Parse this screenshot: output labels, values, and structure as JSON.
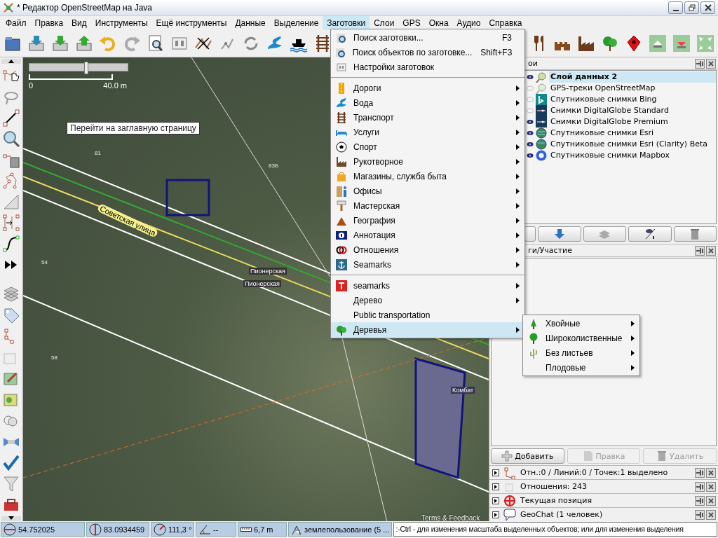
{
  "window": {
    "title": "* Редактор OpenStreetMap на Java"
  },
  "menu_bar": [
    {
      "label": "Файл",
      "selected": false
    },
    {
      "label": "Правка",
      "selected": false
    },
    {
      "label": "Вид",
      "selected": false
    },
    {
      "label": "Инструменты",
      "selected": false
    },
    {
      "label": "Ещё инструменты",
      "selected": false
    },
    {
      "label": "Данные",
      "selected": false
    },
    {
      "label": "Выделение",
      "selected": false
    },
    {
      "label": "Заготовки",
      "selected": true
    },
    {
      "label": "Слои",
      "selected": false
    },
    {
      "label": "GPS",
      "selected": false
    },
    {
      "label": "Окна",
      "selected": false
    },
    {
      "label": "Аудио",
      "selected": false
    },
    {
      "label": "Справка",
      "selected": false
    }
  ],
  "presets_menu": {
    "sections": [
      [
        {
          "label": "Поиск заготовки...",
          "shortcut": "F3",
          "submenu": false,
          "selected": false
        },
        {
          "label": "Поиск объектов по заготовке...",
          "shortcut": "Shift+F3",
          "submenu": false,
          "selected": false
        },
        {
          "label": "Настройки заготовок",
          "submenu": false,
          "selected": false
        }
      ],
      [
        {
          "label": "Дороги",
          "submenu": true,
          "selected": false
        },
        {
          "label": "Вода",
          "submenu": true,
          "selected": false
        },
        {
          "label": "Транспорт",
          "submenu": true,
          "selected": false
        },
        {
          "label": "Услуги",
          "submenu": true,
          "selected": false
        },
        {
          "label": "Спорт",
          "submenu": true,
          "selected": false
        },
        {
          "label": "Рукотворное",
          "submenu": true,
          "selected": false
        },
        {
          "label": "Магазины, служба быта",
          "submenu": true,
          "selected": false
        },
        {
          "label": "Офисы",
          "submenu": true,
          "selected": false
        },
        {
          "label": "Мастерская",
          "submenu": true,
          "selected": false
        },
        {
          "label": "География",
          "submenu": true,
          "selected": false
        },
        {
          "label": "Аннотация",
          "submenu": true,
          "selected": false
        },
        {
          "label": "Отношения",
          "submenu": true,
          "selected": false
        },
        {
          "label": "Seamarks",
          "submenu": true,
          "selected": false
        }
      ],
      [
        {
          "label": "seamarks",
          "submenu": true,
          "selected": false
        },
        {
          "label": "Дерево",
          "submenu": true,
          "selected": false
        },
        {
          "label": "Public transportation",
          "submenu": false,
          "selected": false
        },
        {
          "label": "Деревья",
          "submenu": true,
          "selected": true
        }
      ]
    ]
  },
  "trees_submenu": [
    {
      "label": "Хвойные",
      "submenu": true
    },
    {
      "label": "Широколиственные",
      "submenu": true
    },
    {
      "label": "Без листьев",
      "submenu": true
    },
    {
      "label": "Плодовые",
      "submenu": true
    }
  ],
  "map": {
    "zoom_slider": {
      "level": 0.58
    },
    "scale": {
      "start": "0",
      "end": "40.0 m"
    },
    "labels": [
      {
        "kind": "tooltip",
        "text": "Перейти на заглавную страницу"
      },
      {
        "kind": "house",
        "text": "81"
      },
      {
        "kind": "house",
        "text": "83Б"
      },
      {
        "kind": "street",
        "text": "Советская улица"
      },
      {
        "kind": "house",
        "text": "54"
      },
      {
        "kind": "stop",
        "text": "Пионерская"
      },
      {
        "kind": "stop",
        "text": "Пионерская"
      },
      {
        "kind": "house",
        "text": "58"
      },
      {
        "kind": "poi",
        "text": "Комбат"
      },
      {
        "kind": "attribution",
        "text": "Terms & Feedback"
      }
    ]
  },
  "layers_panel": {
    "title": "ои",
    "layers": [
      {
        "name": "Слой данных 2",
        "visible": true,
        "selected": true
      },
      {
        "name": "GPS-треки OpenStreetMap",
        "visible": false,
        "selected": false
      },
      {
        "name": "Спутниковые снимки Bing",
        "visible": false,
        "selected": false
      },
      {
        "name": "Снимки DigitalGlobe Standard",
        "visible": false,
        "selected": false
      },
      {
        "name": "Снимки DigitalGlobe Premium",
        "visible": true,
        "selected": false
      },
      {
        "name": "Спутниковые снимки Esri",
        "visible": true,
        "selected": false
      },
      {
        "name": "Спутниковые снимки Esri (Clarity) Beta",
        "visible": true,
        "selected": false
      },
      {
        "name": "Спутниковые снимки Mapbox",
        "visible": true,
        "selected": false
      }
    ]
  },
  "tags_panel": {
    "title": "ги/Участие",
    "buttons": [
      {
        "label": "Добавить",
        "disabled": false
      },
      {
        "label": "Правка",
        "disabled": true
      },
      {
        "label": "Удалить",
        "disabled": true
      }
    ]
  },
  "collapsed_panels": [
    {
      "title": "Отн.:0 / Линий:0 / Точек:1 выделено"
    },
    {
      "title": "Отношения: 243"
    },
    {
      "title": "Текущая позиция"
    },
    {
      "title": "GeoChat (1 человек)"
    }
  ],
  "status_bar": {
    "latitude": "54.752025",
    "longitude": "83.0934459",
    "heading": "111,3 °",
    "angle": "--",
    "distance": "6,7 m",
    "tags": "землепользование (5 ...",
    "help": ":-Ctrl - для изменения масштаба выделенных объектов; или для изменения выделения"
  }
}
